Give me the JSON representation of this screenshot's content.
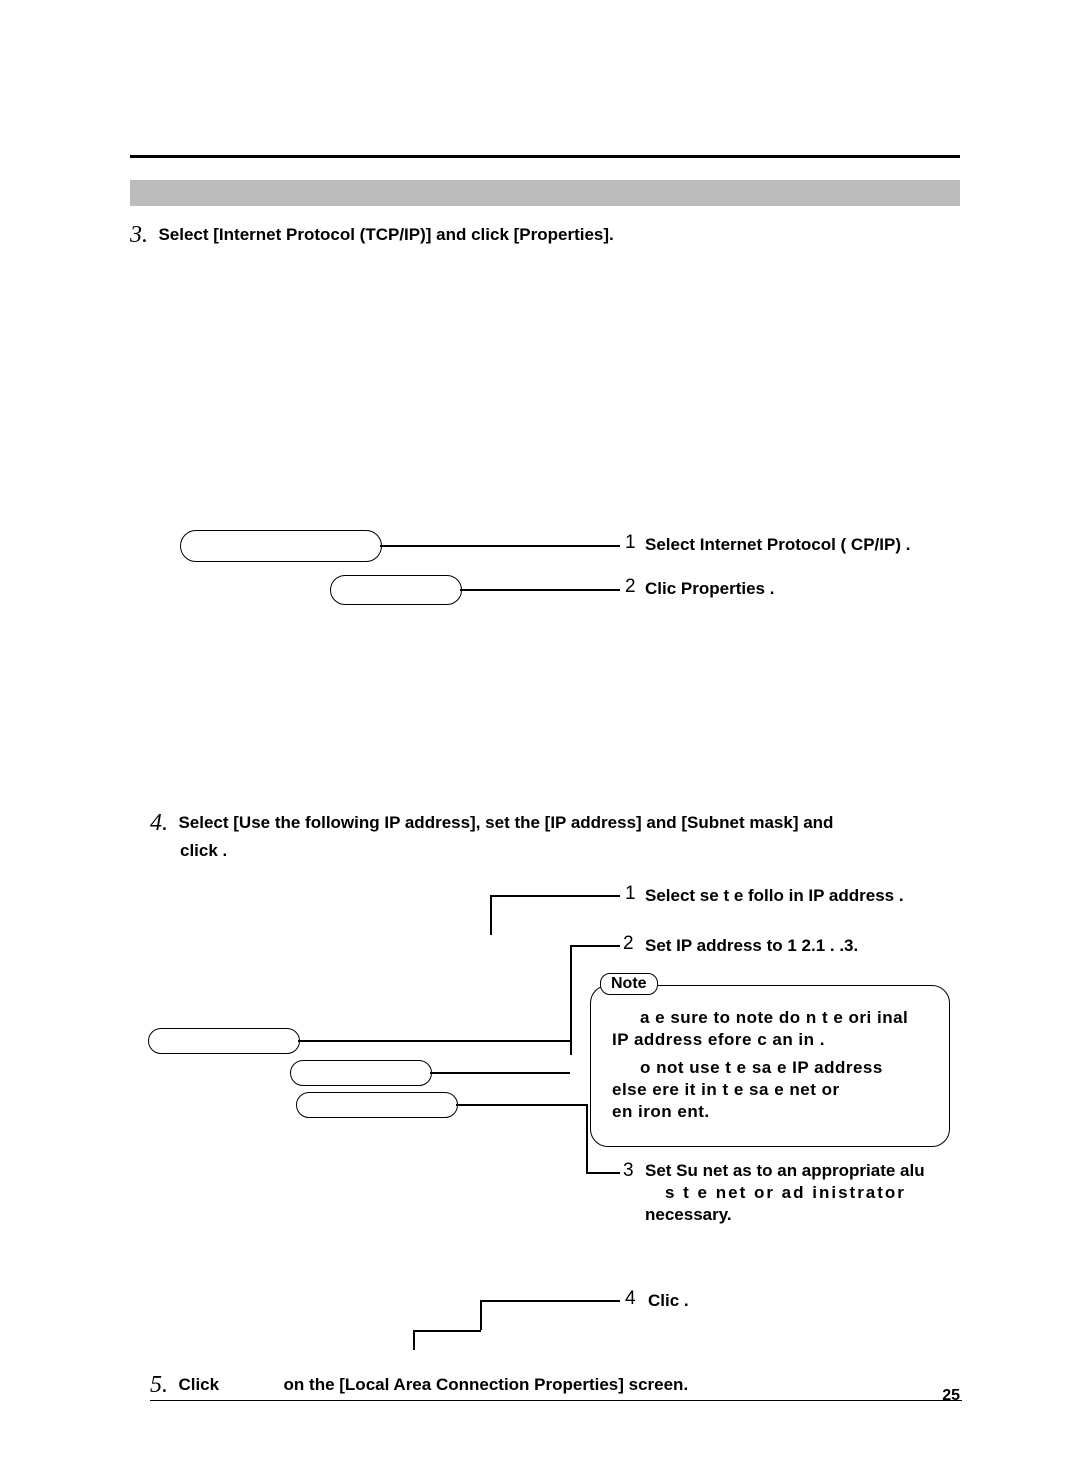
{
  "page_number": "25",
  "step3": {
    "num": "3.",
    "text": "Select [Internet Protocol (TCP/IP)] and click [Properties].",
    "c1_num": "1",
    "c1_txt": "Select  Internet Protocol (  CP/IP) .",
    "c2_num": "2",
    "c2_txt": "Clic    Properties ."
  },
  "step4": {
    "num": "4.",
    "text_a": "Select [Use the following IP address], set the [IP address] and [Subnet mask] and",
    "text_b": "click           .",
    "c1_num": "1",
    "c1_txt": "Select    se t  e follo  in   IP address .",
    "c2_num": "2",
    "c2_txt": "Set  IP address  to 1  2.1    .  .3.",
    "note_label": "Note",
    "note_line1": "a  e sure to note do   n t  e ori  inal",
    "note_line2": "IP address   efore c  an  in  .",
    "note_line3": "o  not  use  t  e  sa   e  IP  address",
    "note_line4": "else     ere    it  in  t  e  sa    e  net    or",
    "note_line5": "en  iron  ent.",
    "c3_num": "3",
    "c3a": "Set Su  net    as   to an appropriate   alu",
    "c3b": "s     t  e   net    or     ad   inistrator",
    "c3c": "necessary.",
    "c4_num": "4",
    "c4_txt": "Clic          ."
  },
  "step5": {
    "num": "5.",
    "text_a": "Click",
    "text_b": "on the [Local Area Connection Properties] screen."
  }
}
